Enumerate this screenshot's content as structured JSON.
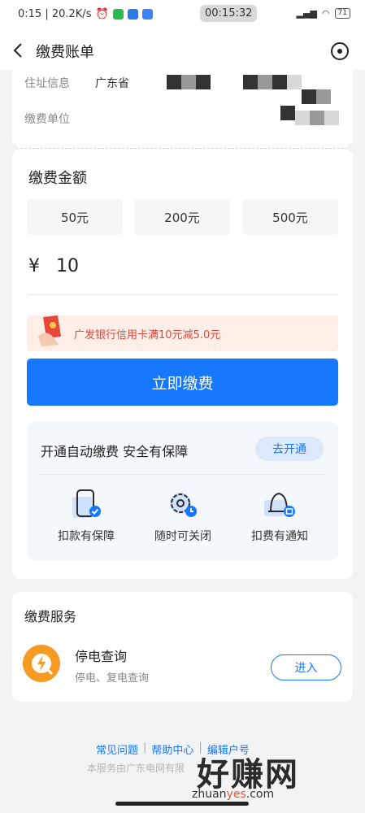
{
  "status_bar": {
    "left_text": "0:15 | 20.2K/s",
    "clock": "00:15:32",
    "battery": "71"
  },
  "header": {
    "title": "缴费账单"
  },
  "address": {
    "addr_label": "住址信息",
    "addr_value": "广东省",
    "unit_label": "缴费单位"
  },
  "amount": {
    "title": "缴费金额",
    "options": [
      "50元",
      "200元",
      "500元"
    ],
    "currency": "¥",
    "value": "10",
    "promo": "广发银行信用卡满10元减5.0元",
    "pay_button": "立即缴费"
  },
  "auto_pay": {
    "title": "开通自动缴费 安全有保障",
    "open_button": "去开通",
    "features": [
      "扣款有保障",
      "随时可关闭",
      "扣费有通知"
    ]
  },
  "service": {
    "title": "缴费服务",
    "item_name": "停电查询",
    "item_desc": "停电、复电查询",
    "enter_button": "进入"
  },
  "footer": {
    "links": [
      "常见问题",
      "帮助中心",
      "编辑户号"
    ],
    "note": "本服务由广东电网有限"
  },
  "watermark": {
    "text": "好赚网",
    "url_a": "zhuan",
    "url_accent": "yes",
    "url_b": ".com"
  },
  "colors": {
    "primary": "#1677ff",
    "promo_text": "#e0483b",
    "promo_bg": "#fdeee8"
  }
}
